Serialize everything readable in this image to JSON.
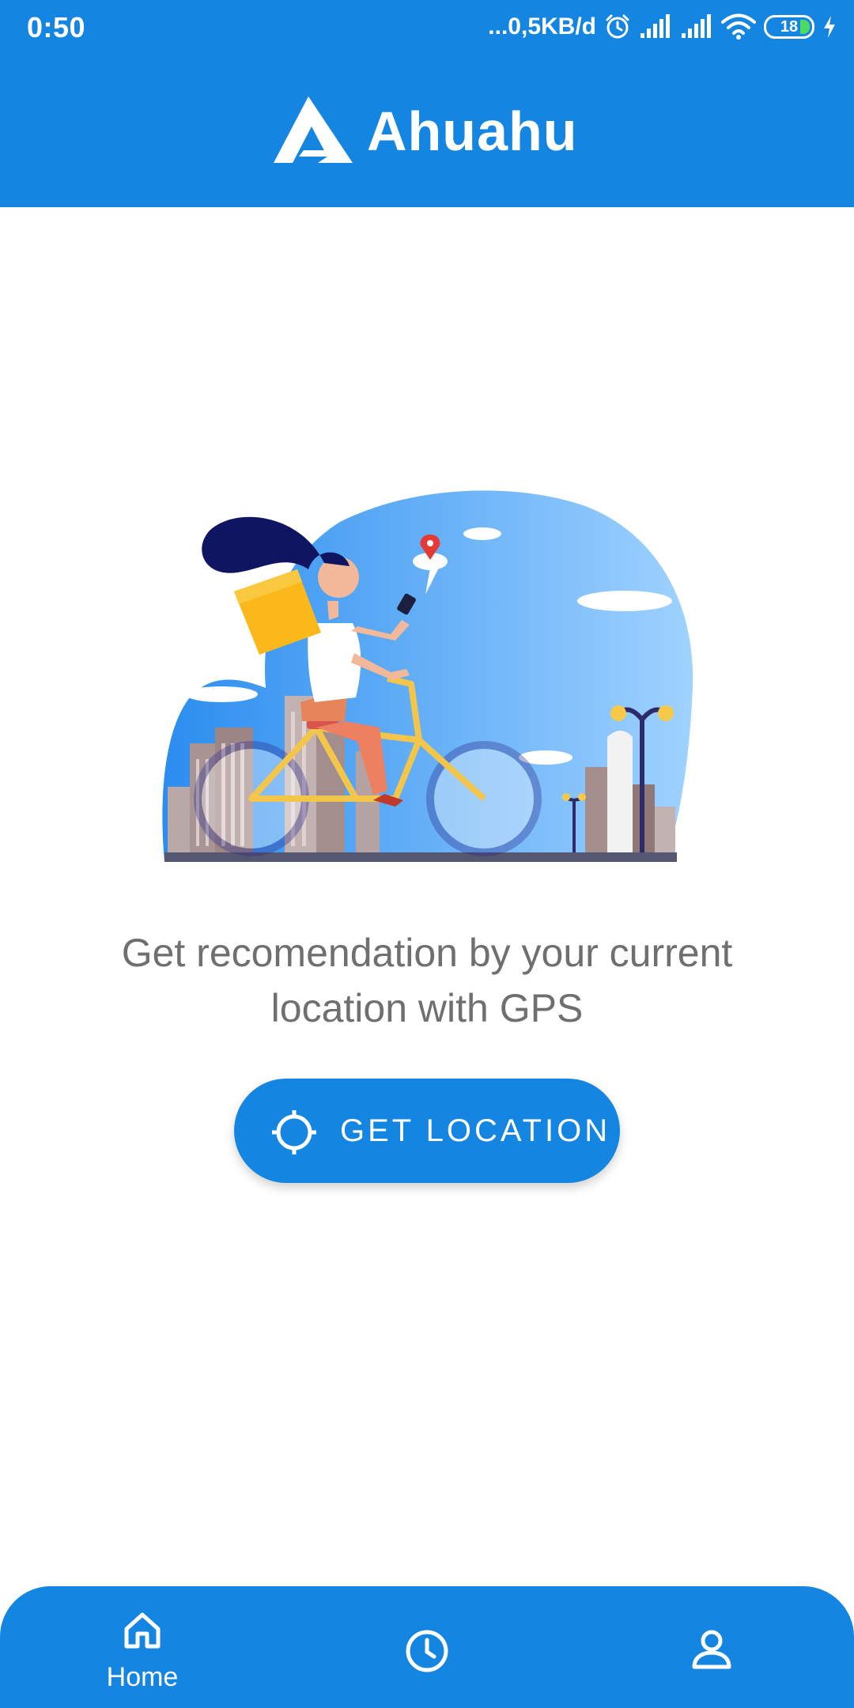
{
  "status_bar": {
    "time": "0:50",
    "network_speed": "...0,5KB/d",
    "battery_level": "18",
    "icons": [
      "alarm-icon",
      "signal-icon",
      "signal-icon",
      "wifi-icon",
      "battery-icon",
      "charging-icon"
    ]
  },
  "header": {
    "logo_icon": "ahuahu-logo",
    "app_name": "Ahuahu"
  },
  "main": {
    "illustration": "delivery-cyclist-city-illustration",
    "message": "Get recomendation by your current location with GPS",
    "button_icon": "crosshair-icon",
    "button_label": "GET LOCATION"
  },
  "bottom_nav": {
    "items": [
      {
        "icon": "home-icon",
        "label": "Home",
        "active": true
      },
      {
        "icon": "clock-icon",
        "label": "",
        "active": false
      },
      {
        "icon": "person-icon",
        "label": "",
        "active": false
      }
    ]
  },
  "colors": {
    "primary": "#1485E0",
    "text_muted": "#6F6F6F",
    "background": "#FFFFFF"
  }
}
